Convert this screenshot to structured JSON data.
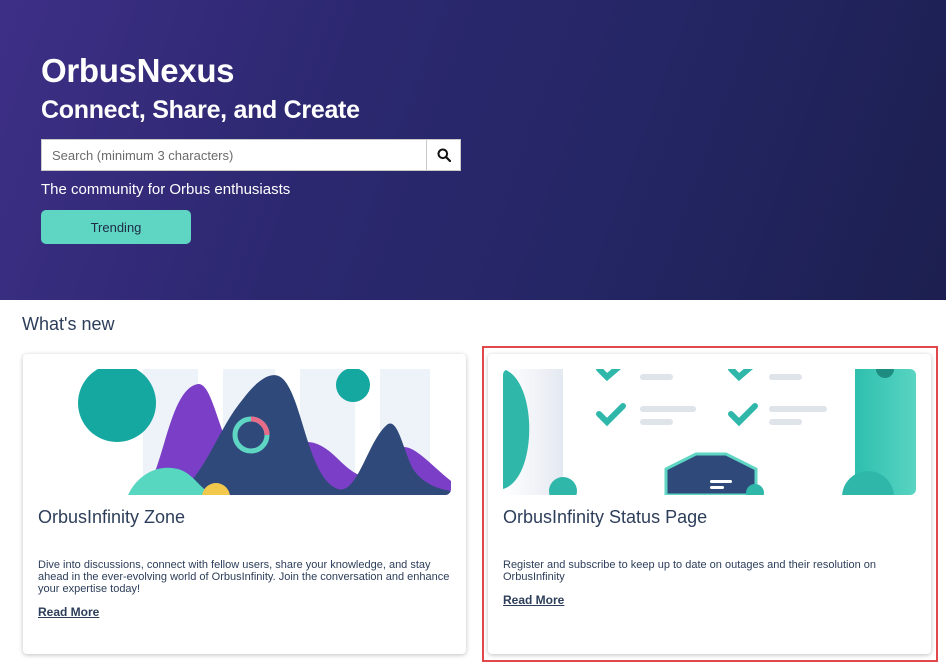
{
  "hero": {
    "title": "OrbusNexus",
    "subtitle": "Connect, Share, and Create",
    "search_placeholder": "Search (minimum 3 characters)",
    "search_icon": "magnifier-icon",
    "tagline": "The community for Orbus enthusiasts",
    "trending_label": "Trending"
  },
  "section": {
    "title": "What's new"
  },
  "cards": [
    {
      "title": "OrbusInfinity Zone",
      "description": "Dive into discussions, connect with fellow users, share your knowledge, and stay ahead in the ever-evolving world of OrbusInfinity. Join the conversation and enhance your expertise today!",
      "link": "Read More"
    },
    {
      "title": "OrbusInfinity Status Page",
      "description": "Register and subscribe to keep up to date on outages and their resolution on OrbusInfinity",
      "link": "Read More"
    }
  ],
  "colors": {
    "hero_start": "#3d2f86",
    "hero_end": "#1c1f4f",
    "accent_teal": "#5ed6c3",
    "text_navy": "#2d3e5a",
    "purple": "#7b3fc4",
    "highlight": "#e0484b"
  }
}
